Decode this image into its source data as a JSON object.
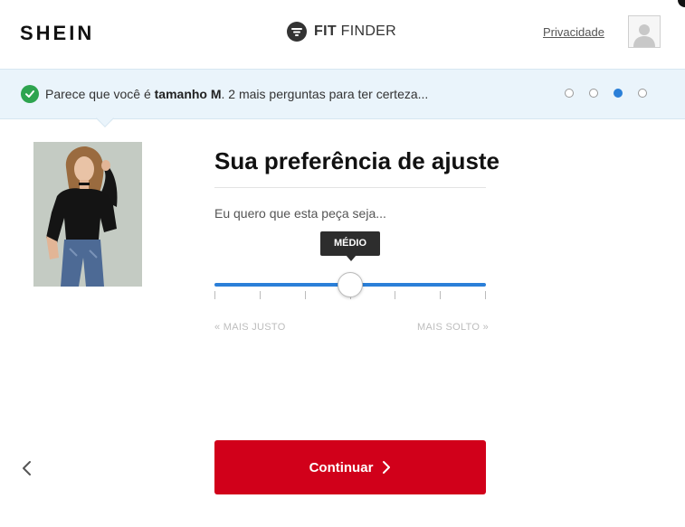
{
  "header": {
    "logo": "SHEIN",
    "brand_bold": "FIT",
    "brand_rest": " FINDER",
    "privacy_label": "Privacidade"
  },
  "banner": {
    "text_before": "Parece que você é ",
    "size_bold": "tamanho M",
    "text_after": ". 2 mais perguntas para ter certeza...",
    "progress_steps": 4,
    "active_step": 3,
    "check_color": "#2ea44f",
    "active_dot_color": "#2b7fd8"
  },
  "main": {
    "title": "Sua preferência de ajuste",
    "subtitle": "Eu quero que esta peça seja...",
    "slider": {
      "value_label": "MÉDIO",
      "value_fraction": 0.5,
      "left_label": "« MAIS JUSTO",
      "right_label": "MAIS SOLTO »",
      "tick_count": 7,
      "track_color": "#2b7fd8"
    }
  },
  "footer": {
    "continue_label": "Continuar",
    "continue_color": "#d1001a",
    "back_icon": "chevron-left-icon"
  }
}
